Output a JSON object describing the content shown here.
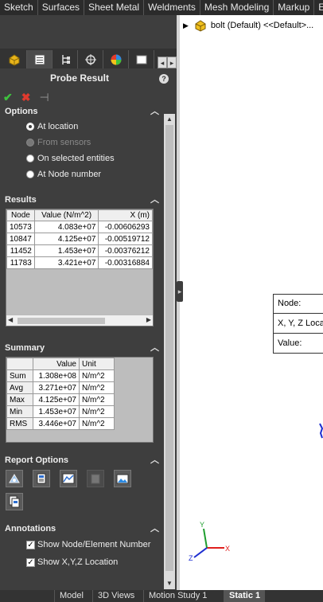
{
  "ribbon": {
    "tabs": [
      "Sketch",
      "Surfaces",
      "Sheet Metal",
      "Weldments",
      "Mesh Modeling",
      "Markup",
      "Ev"
    ]
  },
  "property_manager": {
    "icons": [
      "part-icon",
      "property-manager-icon",
      "configuration-manager-icon",
      "dimxpert-icon",
      "display-manager-icon",
      "simulation-icon"
    ],
    "title": "Probe Result",
    "help": "?",
    "ok_glyph": "✔",
    "cancel_glyph": "✖",
    "pin_glyph": "⊣"
  },
  "options": {
    "header": "Options",
    "items": [
      {
        "label": "At location",
        "selected": true,
        "enabled": true
      },
      {
        "label": "From sensors",
        "selected": false,
        "enabled": false
      },
      {
        "label": "On selected entities",
        "selected": false,
        "enabled": true
      },
      {
        "label": "At Node number",
        "selected": false,
        "enabled": true
      }
    ]
  },
  "results": {
    "header": "Results",
    "columns": [
      "Node",
      "Value (N/m^2)",
      "X (m)"
    ],
    "rows": [
      [
        "10573",
        "4.083e+07",
        "-0.00606293"
      ],
      [
        "10847",
        "4.125e+07",
        "-0.00519712"
      ],
      [
        "11452",
        "1.453e+07",
        "-0.00376212"
      ],
      [
        "11783",
        "3.421e+07",
        "-0.00316884"
      ]
    ]
  },
  "summary": {
    "header": "Summary",
    "columns": [
      "Value",
      "Unit"
    ],
    "rows": [
      {
        "label": "Sum",
        "value": "1.308e+08",
        "unit": "N/m^2"
      },
      {
        "label": "Avg",
        "value": "3.271e+07",
        "unit": "N/m^2"
      },
      {
        "label": "Max",
        "value": "4.125e+07",
        "unit": "N/m^2"
      },
      {
        "label": "Min",
        "value": "1.453e+07",
        "unit": "N/m^2"
      },
      {
        "label": "RMS",
        "value": "3.446e+07",
        "unit": "N/m^2"
      }
    ]
  },
  "report_options": {
    "header": "Report Options",
    "buttons": [
      "save-as-sensor-icon",
      "save-to-file-icon",
      "plot-icon",
      "save-to-report-icon",
      "save-image-icon",
      "copy-icon"
    ]
  },
  "annotations": {
    "header": "Annotations",
    "items": [
      {
        "label": "Show Node/Element Number",
        "checked": true
      },
      {
        "label": "Show X,Y,Z Location",
        "checked": true
      }
    ]
  },
  "graphics": {
    "tree_item": "bolt (Default) <<Default>...",
    "popup": {
      "node": "Node:",
      "xyz": "X, Y, Z Locati",
      "value": "Value:"
    },
    "triad": {
      "x": "X",
      "y": "Y",
      "z": "Z"
    }
  },
  "bottom_tabs": [
    {
      "label": "Model",
      "active": false
    },
    {
      "label": "3D Views",
      "active": false
    },
    {
      "label": "Motion Study 1",
      "active": false
    },
    {
      "label": "Static 1",
      "active": true
    }
  ],
  "colors": {
    "panel_bg": "#3e3e3e",
    "ok_green": "#3ec23e",
    "cancel_red": "#e03a2e",
    "triad_x": "#e0201e",
    "triad_y": "#1e9e2e",
    "triad_z": "#1e2ed0"
  }
}
